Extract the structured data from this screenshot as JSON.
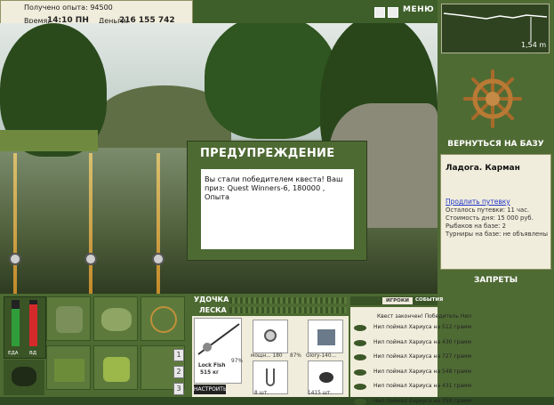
{
  "header": {
    "experience_label": "Получено опыта: 94500",
    "time_label": "Время:",
    "time_value": "14:10 ПН",
    "money_label": "Деньги:",
    "money_value": "216 155 742 руб.",
    "menu_label": "МЕНЮ"
  },
  "map": {
    "depth": "1,54 m"
  },
  "dialog": {
    "title": "ПРЕДУПРЕЖДЕНИЕ",
    "message": "Вы стали победителем квеста! Ваш приз: Quest Winners-6, 180000 , Опыта"
  },
  "right_panel": {
    "return_button": "ВЕРНУТЬСЯ НА БАЗУ",
    "location": "Ладога. Карман",
    "extend_trip_link": "Продлить путевку",
    "trip_left": "Осталось путевки: 11 час.",
    "day_cost": "Стоимость дня: 15 000 руб.",
    "anglers_on_base": "Рыбаков на базе: 2",
    "tournaments": "Турниры на базе: не объявлены",
    "bans_button": "ЗАПРЕТЫ"
  },
  "gauges": {
    "left_label": "ЕДА",
    "right_label": "ВД",
    "food_level": 0.8,
    "energy_level": 0.9
  },
  "inventory": {
    "page_numbers": [
      "1",
      "2",
      "3"
    ]
  },
  "tackle": {
    "rod_label": "УДОЧКА",
    "line_label": "ЛЕСКА",
    "rod_name": "Lock Fish",
    "rod_weight": "515 кг",
    "rod_wear": "97%",
    "reel_caption": "мощн... 180",
    "reel_wear": "87%",
    "item3_caption": "Glory-140...",
    "hook_count": "8 шт.",
    "bait_count": "1415 шт.",
    "setup_button": "НАСТРОИТЬ"
  },
  "chat": {
    "tab_players": "ИГРОКИ",
    "tab_events": "СОБЫТИЯ",
    "quest_line": "Квест закончен! Победитель Нил",
    "lines": [
      "Нил поймал Хариуса на 512 грамм",
      "Нил поймал Хариуса на 430 грамм",
      "Нил поймал Хариуса на 727 грамм",
      "Нил поймал Хариуса на 548 грамм",
      "Нил поймал Хариуса на 431 грамм",
      "Нил поймал Хариуса на 358 грамм"
    ]
  }
}
